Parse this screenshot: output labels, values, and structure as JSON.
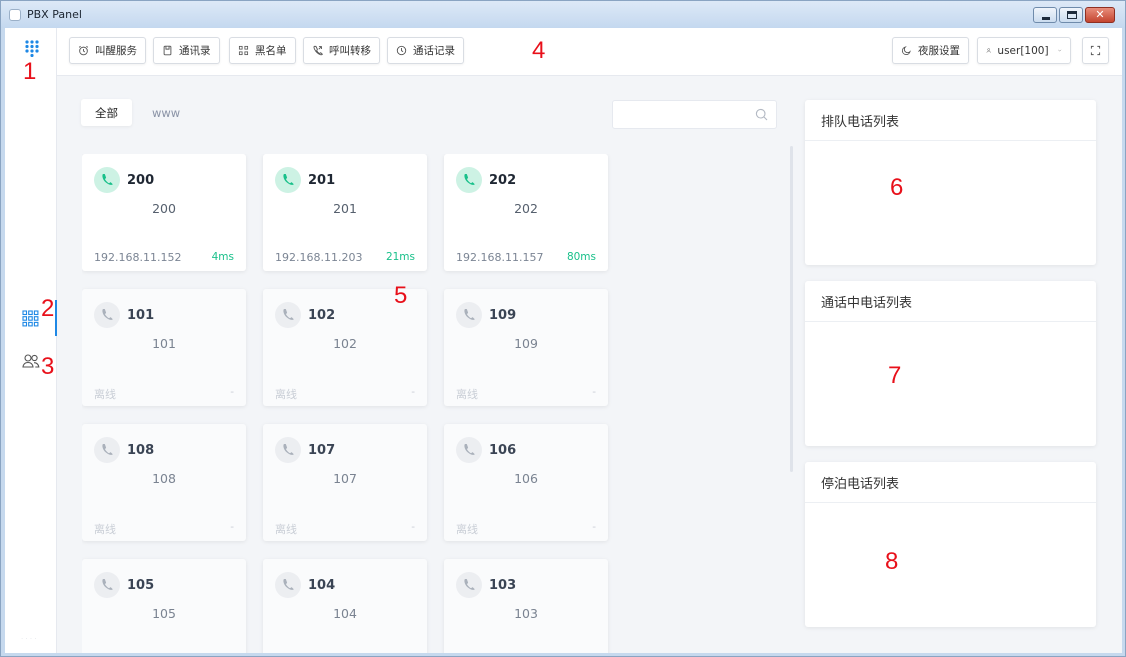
{
  "window": {
    "title": "PBX Panel",
    "close_glyph": "✕"
  },
  "toolbar": {
    "buttons": [
      {
        "label": "叫醒服务",
        "icon": "alarm-clock-icon"
      },
      {
        "label": "通讯录",
        "icon": "address-book-icon"
      },
      {
        "label": "黑名单",
        "icon": "grid-blocklist-icon"
      },
      {
        "label": "呼叫转移",
        "icon": "phone-forward-icon"
      },
      {
        "label": "通话记录",
        "icon": "clock-history-icon"
      }
    ],
    "night_mode": {
      "label": "夜服设置",
      "icon": "moon-icon"
    },
    "user": {
      "label": "user[100]",
      "icon": "user-icon"
    },
    "fullscreen_icon": "fullscreen-icon"
  },
  "sidebar": {
    "logo_icon": "dialpad-logo-icon",
    "items": [
      {
        "name": "extensions",
        "icon": "grid-icon",
        "active": true
      },
      {
        "name": "contacts",
        "icon": "users-icon",
        "active": false
      }
    ]
  },
  "tabs": [
    {
      "label": "全部",
      "active": true
    },
    {
      "label": "www",
      "active": false
    }
  ],
  "search": {
    "placeholder": "",
    "value": ""
  },
  "extensions": [
    {
      "number": "200",
      "name": "200",
      "ip": "192.168.11.152",
      "latency": "4ms",
      "online": true
    },
    {
      "number": "201",
      "name": "201",
      "ip": "192.168.11.203",
      "latency": "21ms",
      "online": true
    },
    {
      "number": "202",
      "name": "202",
      "ip": "192.168.11.157",
      "latency": "80ms",
      "online": true
    },
    {
      "number": "101",
      "name": "101",
      "ip": "离线",
      "latency": "-",
      "online": false
    },
    {
      "number": "102",
      "name": "102",
      "ip": "离线",
      "latency": "-",
      "online": false
    },
    {
      "number": "109",
      "name": "109",
      "ip": "离线",
      "latency": "-",
      "online": false
    },
    {
      "number": "108",
      "name": "108",
      "ip": "离线",
      "latency": "-",
      "online": false
    },
    {
      "number": "107",
      "name": "107",
      "ip": "离线",
      "latency": "-",
      "online": false
    },
    {
      "number": "106",
      "name": "106",
      "ip": "离线",
      "latency": "-",
      "online": false
    },
    {
      "number": "105",
      "name": "105",
      "ip": "",
      "latency": "",
      "online": false
    },
    {
      "number": "104",
      "name": "104",
      "ip": "",
      "latency": "",
      "online": false
    },
    {
      "number": "103",
      "name": "103",
      "ip": "",
      "latency": "",
      "online": false
    }
  ],
  "panels": {
    "queue": {
      "title": "排队电话列表"
    },
    "active": {
      "title": "通话中电话列表"
    },
    "parked": {
      "title": "停泊电话列表"
    }
  },
  "annotations": [
    "1",
    "2",
    "3",
    "4",
    "5",
    "6",
    "7",
    "8"
  ],
  "colors": {
    "accent": "#1e88e5",
    "online_green": "#19c08a",
    "annotation_red": "#e8101a"
  }
}
